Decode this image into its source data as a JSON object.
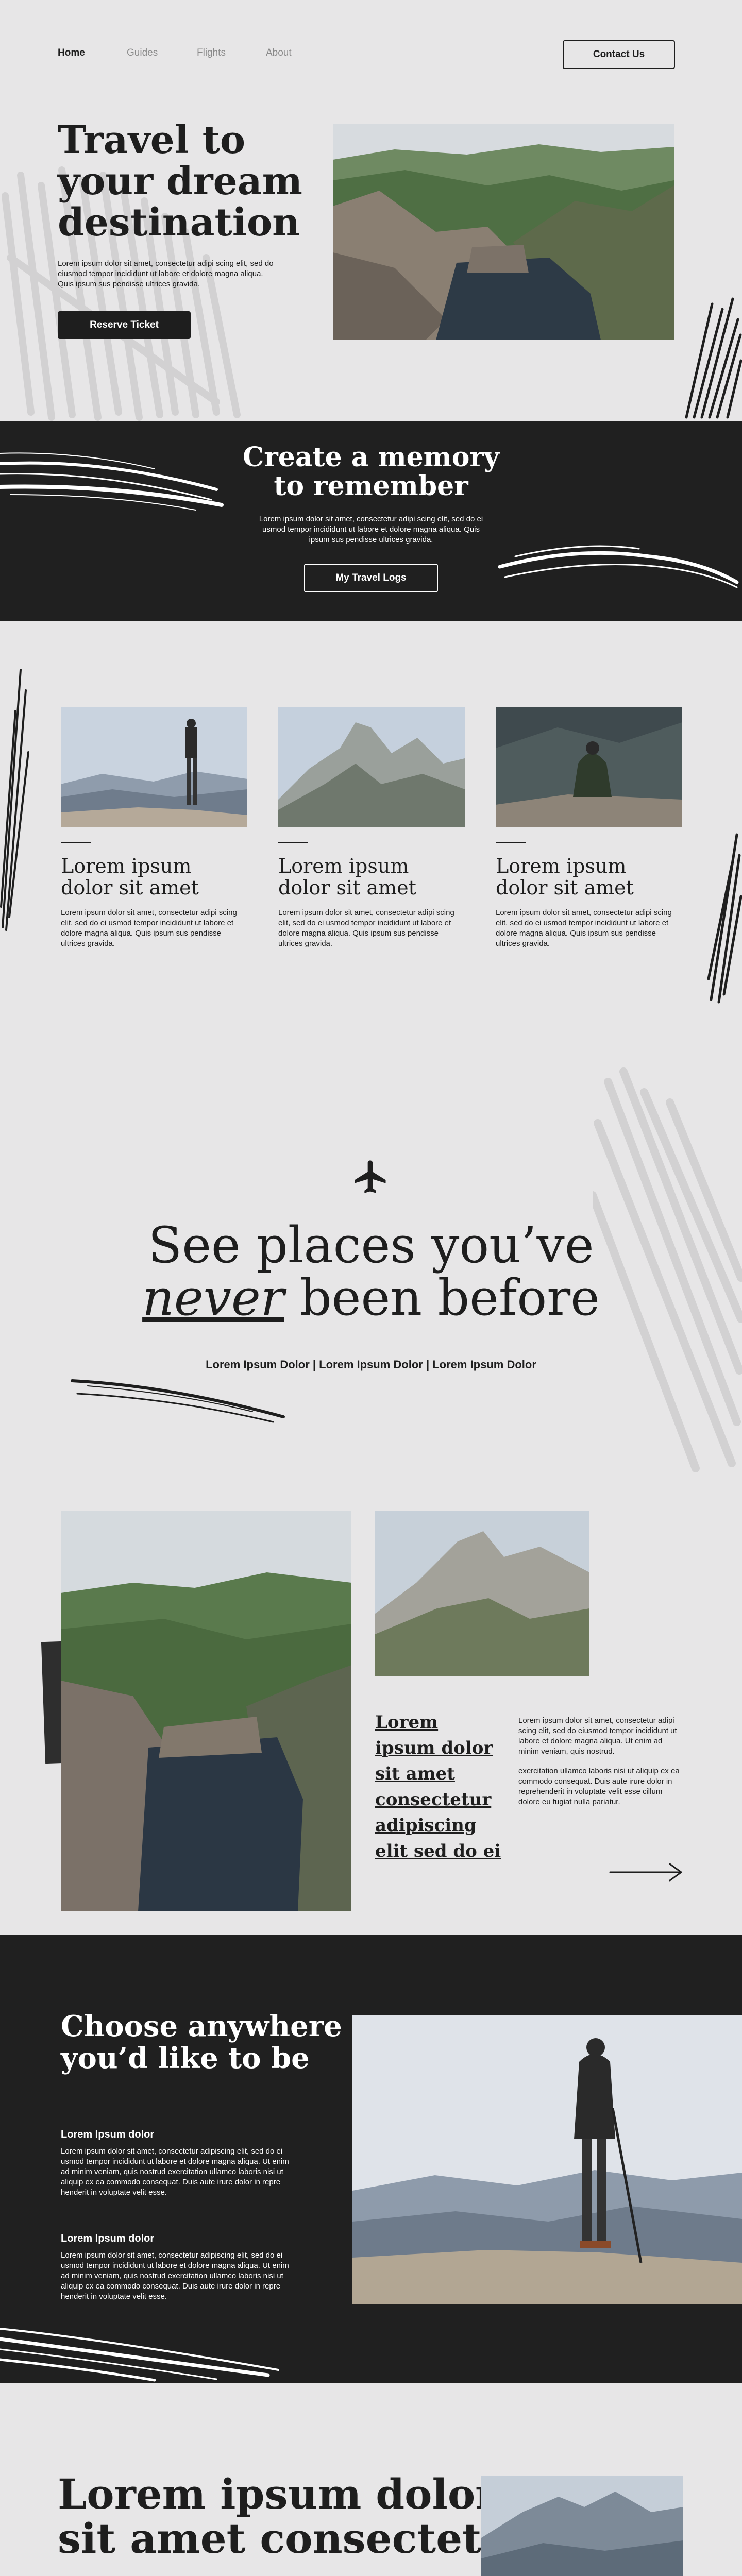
{
  "nav": {
    "home": "Home",
    "guides": "Guides",
    "flights": "Flights",
    "about": "About",
    "contact": "Contact Us"
  },
  "hero": {
    "title_line1": "Travel to",
    "title_line2": "your dream",
    "title_line3": "destination",
    "body": "Lorem ipsum dolor sit amet, consectetur adipi scing elit, sed do eiusmod tempor incididunt ut labore et dolore magna aliqua. Quis ipsum sus pendisse ultrices gravida.",
    "button": "Reserve Ticket"
  },
  "memory": {
    "title_line1": "Create a memory",
    "title_line2": "to remember",
    "body": "Lorem ipsum dolor sit amet, consectetur adipi scing elit, sed do ei usmod tempor incididunt ut labore et dolore magna aliqua. Quis ipsum sus pendisse ultrices gravida.",
    "button": "My Travel Logs"
  },
  "cards": [
    {
      "title_line1": "Lorem ipsum",
      "title_line2": "dolor sit amet",
      "body": "Lorem ipsum dolor sit amet, consectetur adipi scing elit, sed do ei usmod tempor incididunt ut labore et dolore magna aliqua. Quis ipsum sus pendisse ultrices gravida."
    },
    {
      "title_line1": "Lorem ipsum",
      "title_line2": "dolor sit amet",
      "body": "Lorem ipsum dolor sit amet, consectetur adipi scing elit, sed do ei usmod tempor incididunt ut labore et dolore magna aliqua. Quis ipsum sus pendisse ultrices gravida."
    },
    {
      "title_line1": "Lorem ipsum",
      "title_line2": "dolor sit amet",
      "body": "Lorem ipsum dolor sit amet, consectetur adipi scing elit, sed do ei usmod tempor incididunt ut labore et dolore magna aliqua. Quis ipsum sus pendisse ultrices gravida."
    }
  ],
  "places": {
    "title_line1": "See places you’ve",
    "title_em": "never",
    "title_rest": " been before",
    "links": "Lorem Ipsum Dolor | Lorem Ipsum Dolor | Lorem Ipsum Dolor"
  },
  "gallery": {
    "link_title": "Lorem ipsum dolor sit amet consectetur adipiscing elit sed do ei",
    "para1": "Lorem ipsum dolor sit amet, consectetur adipi scing elit, sed do eiusmod tempor incididunt ut labore et dolore magna aliqua. Ut enim ad minim veniam, quis nostrud.",
    "para2": "exercitation ullamco laboris nisi ut aliquip ex ea commodo consequat. Duis aute irure dolor in reprehenderit in voluptate velit esse cillum dolore eu fugiat nulla pariatur."
  },
  "choose": {
    "title_line1": "Choose anywhere",
    "title_line2": "you’d like to be",
    "item1_title": "Lorem Ipsum dolor",
    "item1_body": "Lorem ipsum dolor sit amet, consectetur adipiscing elit, sed do ei usmod tempor incididunt ut labore et dolore magna aliqua. Ut enim ad minim veniam, quis nostrud exercitation ullamco laboris nisi ut aliquip ex ea commodo consequat. Duis aute irure dolor in repre henderit in voluptate velit esse.",
    "item2_title": "Lorem Ipsum dolor",
    "item2_body": "Lorem ipsum dolor sit amet, consectetur adipiscing elit, sed do ei usmod tempor incididunt ut labore et dolore magna aliqua. Ut enim ad minim veniam, quis nostrud exercitation ullamco laboris nisi ut aliquip ex ea commodo consequat. Duis aute irure dolor in repre henderit in voluptate velit esse."
  },
  "footer": {
    "title_line1": "Lorem ipsum dolor",
    "title_line2": "sit amet consectetur"
  },
  "icons": {
    "plane": "airplane-icon",
    "arrow": "arrow-right-icon"
  },
  "colors": {
    "background": "#e7e6e7",
    "dark": "#202020",
    "text": "#1e1e1e",
    "muted": "#8a8a8a"
  }
}
